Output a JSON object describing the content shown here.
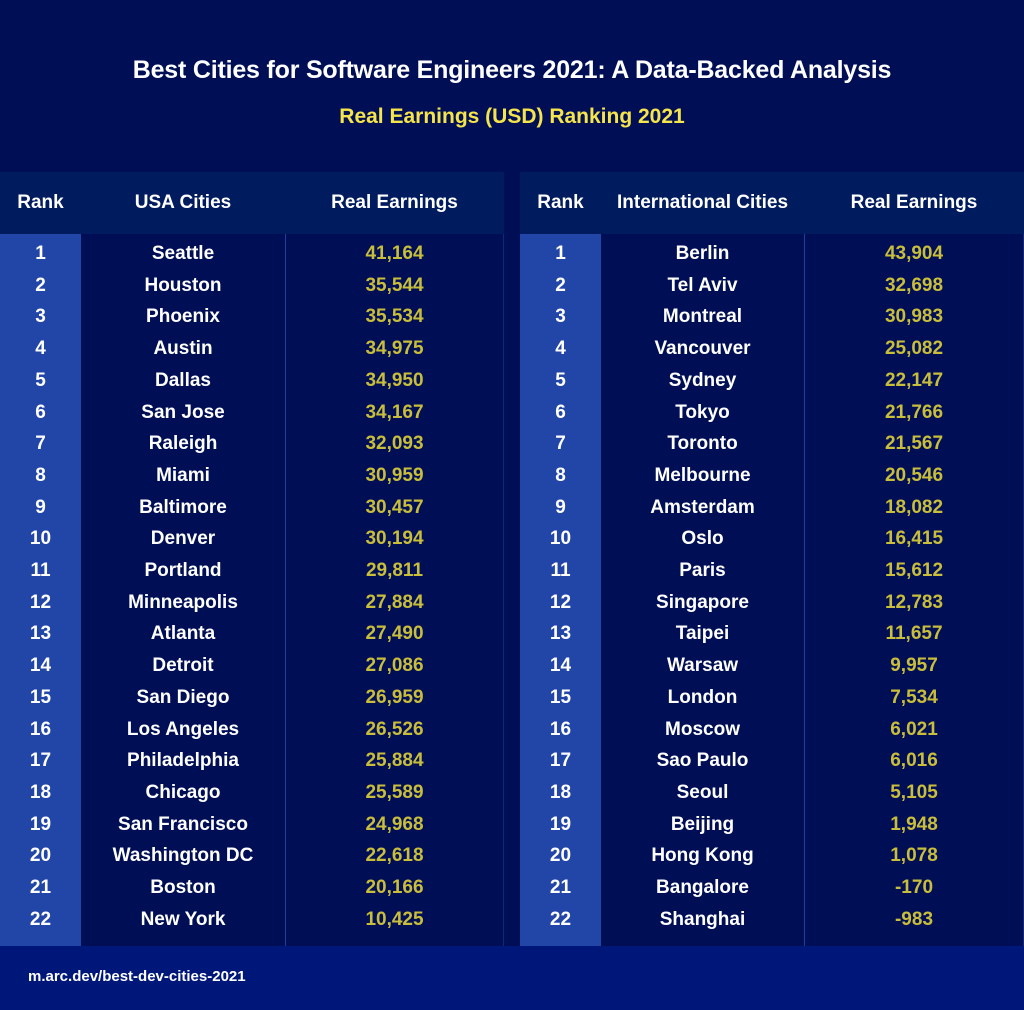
{
  "title": "Best Cities for Software Engineers 2021: A Data-Backed Analysis",
  "subtitle": "Real Earnings (USD) Ranking 2021",
  "colors": {
    "background": "#000f55",
    "header_band": "#001b5e",
    "rank_column": "#2246a8",
    "footer": "#00177a",
    "title_text": "#ffffff",
    "subtitle_text": "#f5e44b",
    "value_text": "#c9bd3c"
  },
  "usa_table": {
    "headers": [
      "Rank",
      "USA Cities",
      "Real Earnings"
    ],
    "rows": [
      {
        "rank": "1",
        "city": "Seattle",
        "earnings": "41,164"
      },
      {
        "rank": "2",
        "city": "Houston",
        "earnings": "35,544"
      },
      {
        "rank": "3",
        "city": "Phoenix",
        "earnings": "35,534"
      },
      {
        "rank": "4",
        "city": "Austin",
        "earnings": "34,975"
      },
      {
        "rank": "5",
        "city": "Dallas",
        "earnings": "34,950"
      },
      {
        "rank": "6",
        "city": "San Jose",
        "earnings": "34,167"
      },
      {
        "rank": "7",
        "city": "Raleigh",
        "earnings": "32,093"
      },
      {
        "rank": "8",
        "city": "Miami",
        "earnings": "30,959"
      },
      {
        "rank": "9",
        "city": "Baltimore",
        "earnings": "30,457"
      },
      {
        "rank": "10",
        "city": "Denver",
        "earnings": "30,194"
      },
      {
        "rank": "11",
        "city": "Portland",
        "earnings": "29,811"
      },
      {
        "rank": "12",
        "city": "Minneapolis",
        "earnings": "27,884"
      },
      {
        "rank": "13",
        "city": "Atlanta",
        "earnings": "27,490"
      },
      {
        "rank": "14",
        "city": "Detroit",
        "earnings": "27,086"
      },
      {
        "rank": "15",
        "city": "San Diego",
        "earnings": "26,959"
      },
      {
        "rank": "16",
        "city": "Los Angeles",
        "earnings": "26,526"
      },
      {
        "rank": "17",
        "city": "Philadelphia",
        "earnings": "25,884"
      },
      {
        "rank": "18",
        "city": "Chicago",
        "earnings": "25,589"
      },
      {
        "rank": "19",
        "city": "San Francisco",
        "earnings": "24,968"
      },
      {
        "rank": "20",
        "city": "Washington DC",
        "earnings": "22,618"
      },
      {
        "rank": "21",
        "city": "Boston",
        "earnings": "20,166"
      },
      {
        "rank": "22",
        "city": "New York",
        "earnings": "10,425"
      }
    ]
  },
  "intl_table": {
    "headers": [
      "Rank",
      "International Cities",
      "Real Earnings"
    ],
    "rows": [
      {
        "rank": "1",
        "city": "Berlin",
        "earnings": "43,904"
      },
      {
        "rank": "2",
        "city": "Tel Aviv",
        "earnings": "32,698"
      },
      {
        "rank": "3",
        "city": "Montreal",
        "earnings": "30,983"
      },
      {
        "rank": "4",
        "city": "Vancouver",
        "earnings": "25,082"
      },
      {
        "rank": "5",
        "city": "Sydney",
        "earnings": "22,147"
      },
      {
        "rank": "6",
        "city": "Tokyo",
        "earnings": "21,766"
      },
      {
        "rank": "7",
        "city": "Toronto",
        "earnings": "21,567"
      },
      {
        "rank": "8",
        "city": "Melbourne",
        "earnings": "20,546"
      },
      {
        "rank": "9",
        "city": "Amsterdam",
        "earnings": "18,082"
      },
      {
        "rank": "10",
        "city": "Oslo",
        "earnings": "16,415"
      },
      {
        "rank": "11",
        "city": "Paris",
        "earnings": "15,612"
      },
      {
        "rank": "12",
        "city": "Singapore",
        "earnings": "12,783"
      },
      {
        "rank": "13",
        "city": "Taipei",
        "earnings": "11,657"
      },
      {
        "rank": "14",
        "city": "Warsaw",
        "earnings": "9,957"
      },
      {
        "rank": "15",
        "city": "London",
        "earnings": "7,534"
      },
      {
        "rank": "16",
        "city": "Moscow",
        "earnings": "6,021"
      },
      {
        "rank": "17",
        "city": "Sao Paulo",
        "earnings": "6,016"
      },
      {
        "rank": "18",
        "city": "Seoul",
        "earnings": "5,105"
      },
      {
        "rank": "19",
        "city": "Beijing",
        "earnings": "1,948"
      },
      {
        "rank": "20",
        "city": "Hong Kong",
        "earnings": "1,078"
      },
      {
        "rank": "21",
        "city": "Bangalore",
        "earnings": "-170"
      },
      {
        "rank": "22",
        "city": "Shanghai",
        "earnings": "-983"
      }
    ]
  },
  "footer": {
    "link": "m.arc.dev/best-dev-cities-2021"
  }
}
